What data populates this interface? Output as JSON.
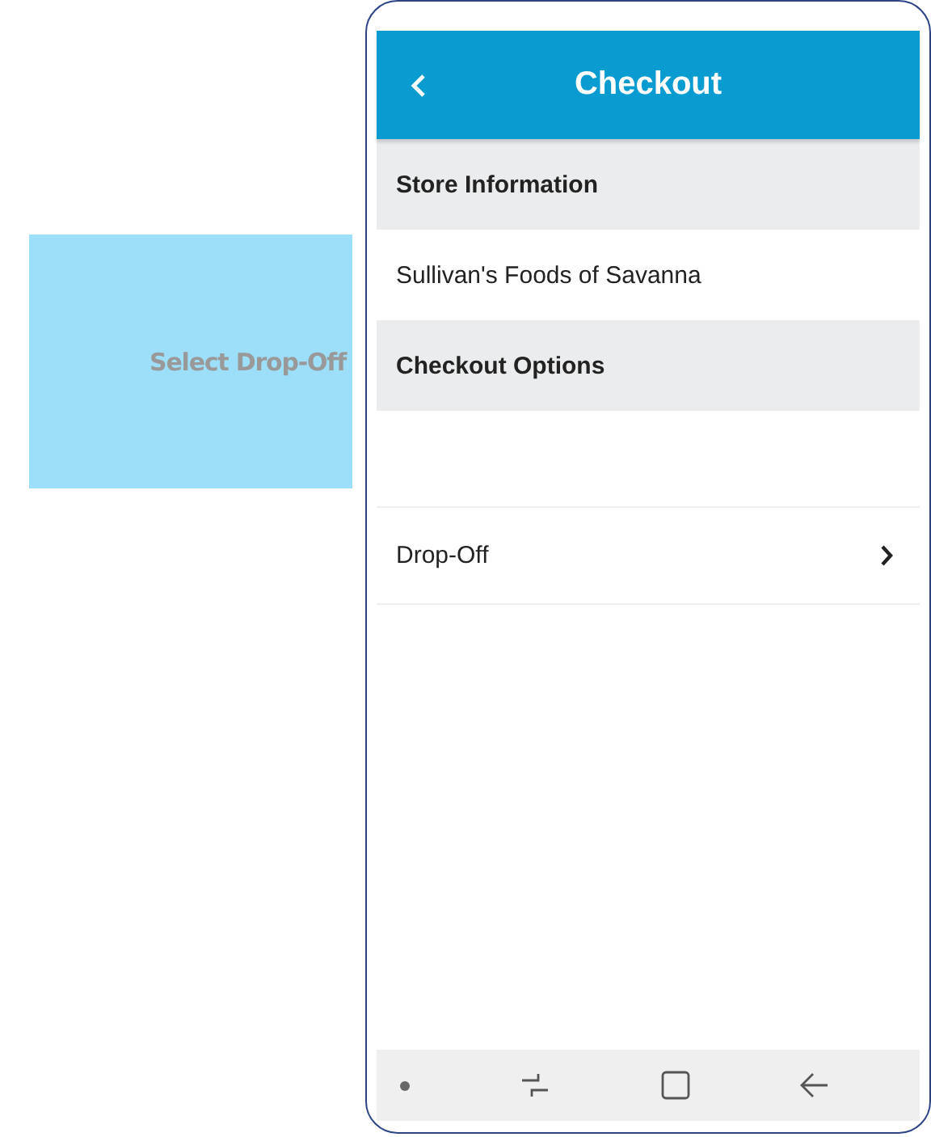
{
  "callout": {
    "text": "Select Drop-Off"
  },
  "header": {
    "title": "Checkout"
  },
  "rows": [
    {
      "kind": "section",
      "label": "Store Information"
    },
    {
      "kind": "text",
      "label": "Sullivan's Foods of Savanna"
    },
    {
      "kind": "section",
      "label": "Checkout Options"
    },
    {
      "kind": "empty"
    },
    {
      "kind": "link",
      "label": "Drop-Off"
    }
  ]
}
